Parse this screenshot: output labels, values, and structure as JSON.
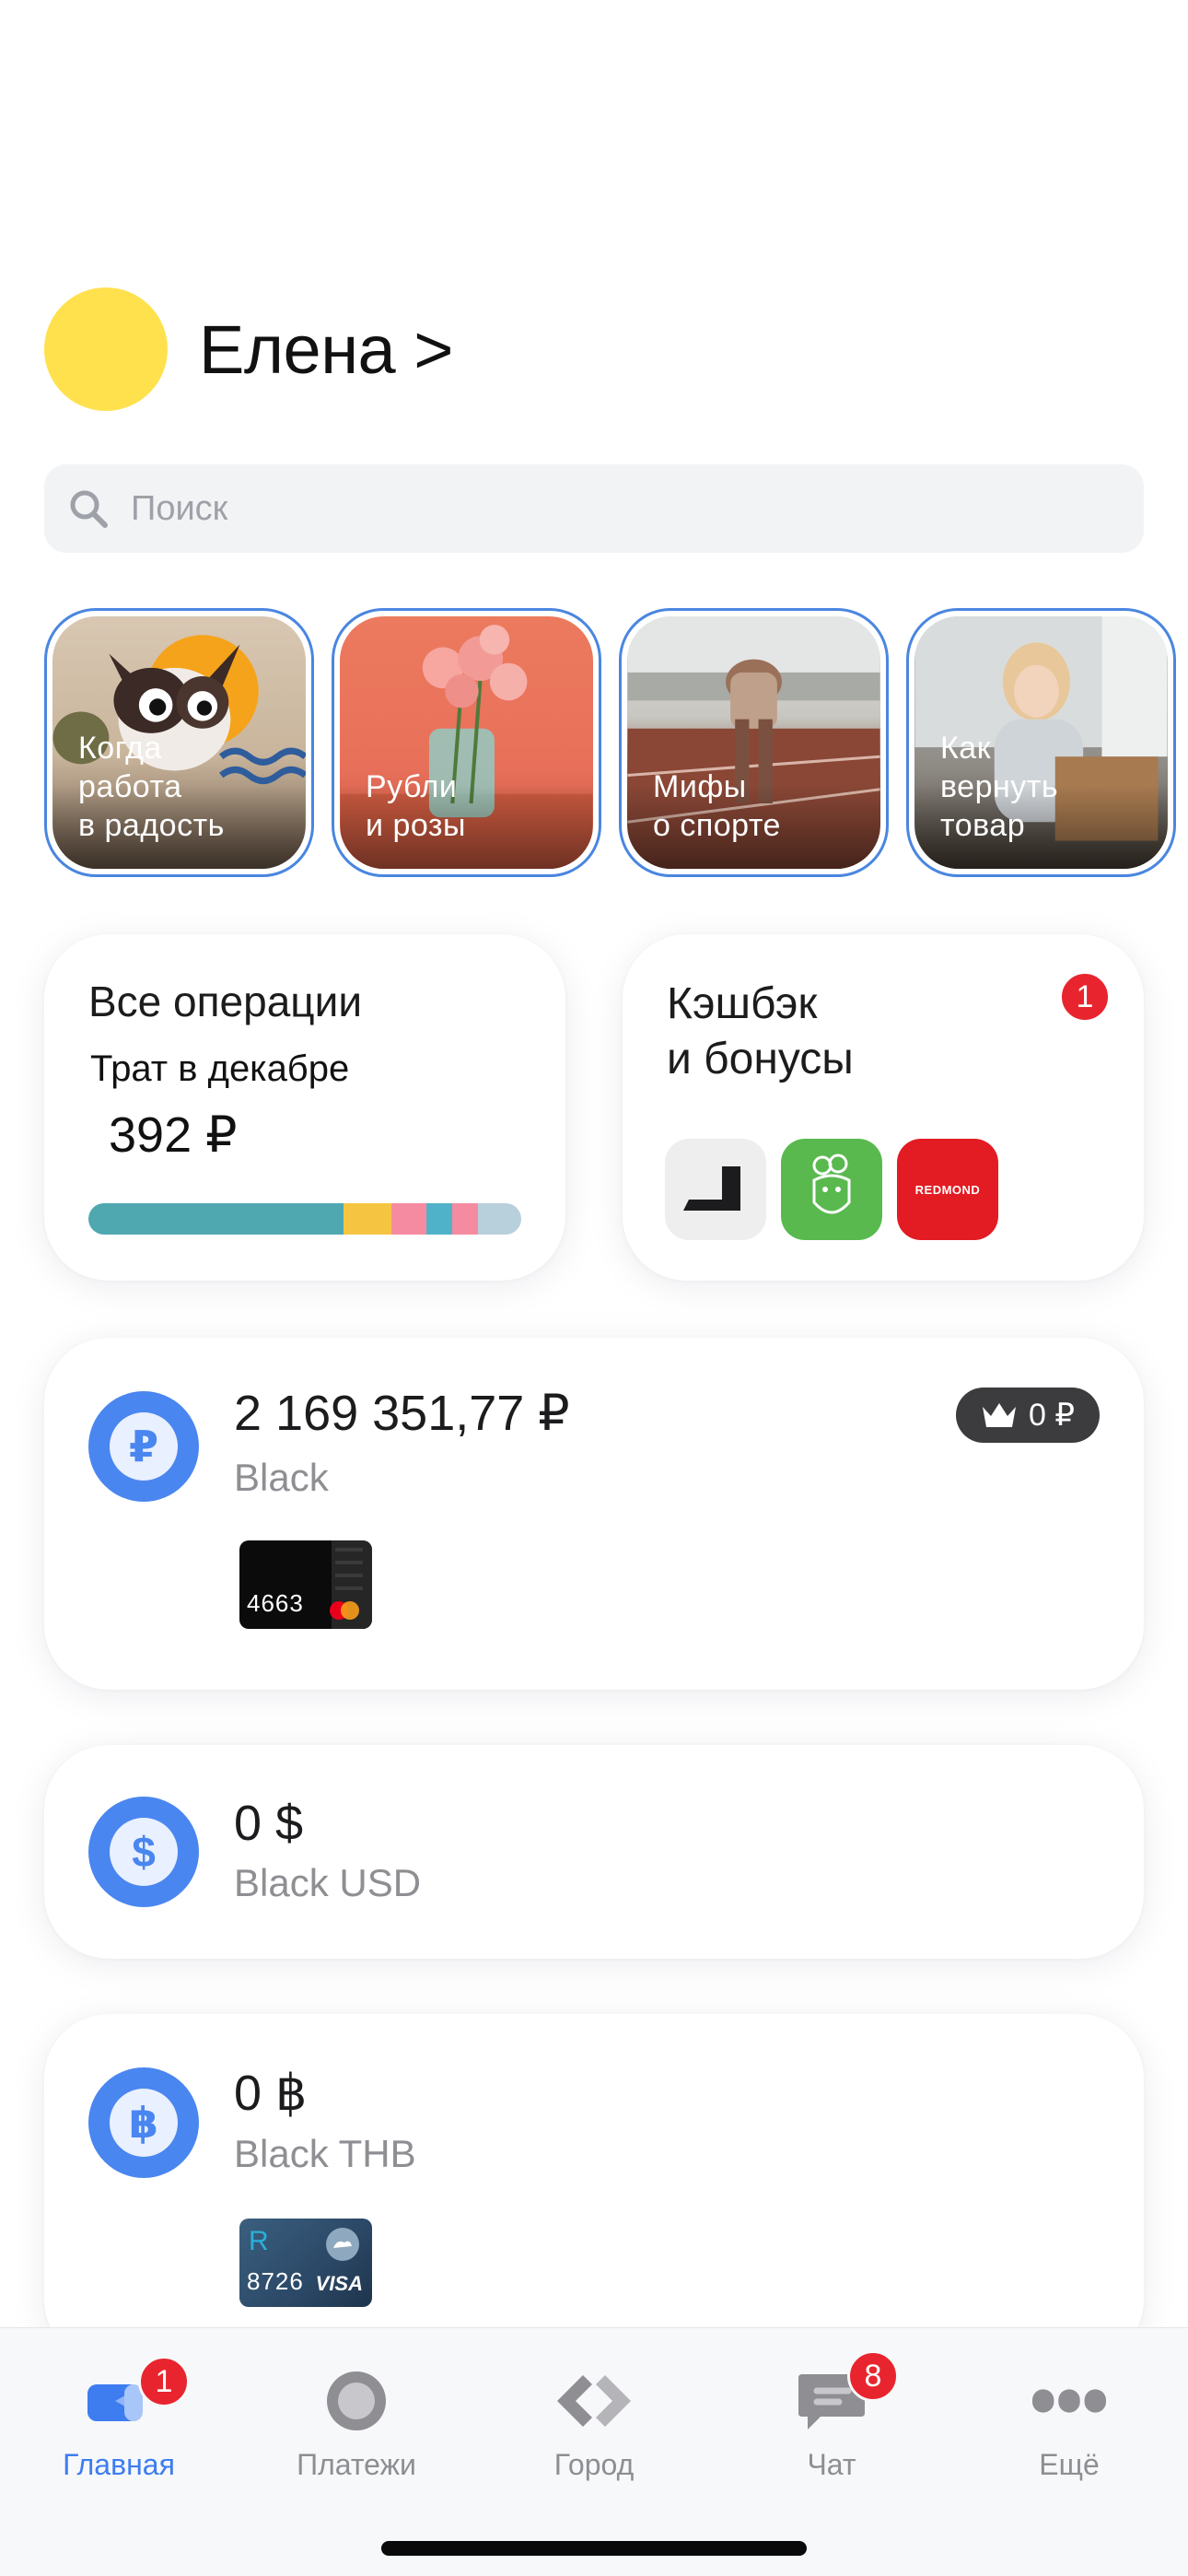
{
  "profile": {
    "name": "Елена >"
  },
  "search": {
    "placeholder": "Поиск"
  },
  "stories": [
    {
      "text": "Когда\nработа\nв радость"
    },
    {
      "text": "Рубли\nи розы"
    },
    {
      "text": "Мифы\nо спорте"
    },
    {
      "text": "Как\nвернуть\nтовар"
    }
  ],
  "operations": {
    "title": "Все операции",
    "subtitle": "Трат в декабре",
    "amount": "392 ₽",
    "bar": [
      {
        "color": "#4fa8b0",
        "share": 0.59
      },
      {
        "color": "#f5c542",
        "share": 0.11
      },
      {
        "color": "#f58ba0",
        "share": 0.08
      },
      {
        "color": "#50b2c8",
        "share": 0.06
      },
      {
        "color": "#f58ba0",
        "share": 0.06
      },
      {
        "color": "#b8cfdc",
        "share": 0.1
      }
    ]
  },
  "cashback": {
    "title": "Кэшбэк\nи бонусы",
    "badge": "1",
    "partners": [
      {
        "icon": "dark-corner-logo",
        "bg": "#eeeeef"
      },
      {
        "icon": "green-mascot-logo",
        "bg": "#59b94f"
      },
      {
        "icon": "redmond-logo",
        "bg": "#e31b23",
        "label": "REDMOND"
      }
    ]
  },
  "accounts": [
    {
      "amount": "2 169 351,77 ₽",
      "name": "Black",
      "currency_symbol": "₽",
      "premium": "0 ₽",
      "card_number": "4663"
    },
    {
      "amount": "0 $",
      "name": "Black USD",
      "currency_symbol": "$"
    },
    {
      "amount": "0 ฿",
      "name": "Black THB",
      "currency_symbol": "฿",
      "card_number": "8726",
      "card_brand": "VISA"
    }
  ],
  "tabbar": {
    "items": [
      {
        "label": "Главная",
        "icon": "home-icon",
        "badge": "1",
        "active": true
      },
      {
        "label": "Платежи",
        "icon": "payments-icon"
      },
      {
        "label": "Город",
        "icon": "city-icon"
      },
      {
        "label": "Чат",
        "icon": "chat-icon",
        "badge": "8"
      },
      {
        "label": "Ещё",
        "icon": "more-icon"
      }
    ]
  },
  "colors": {
    "accent": "#3d7df0",
    "badge": "#e8252e",
    "avatar": "#ffe14d"
  }
}
